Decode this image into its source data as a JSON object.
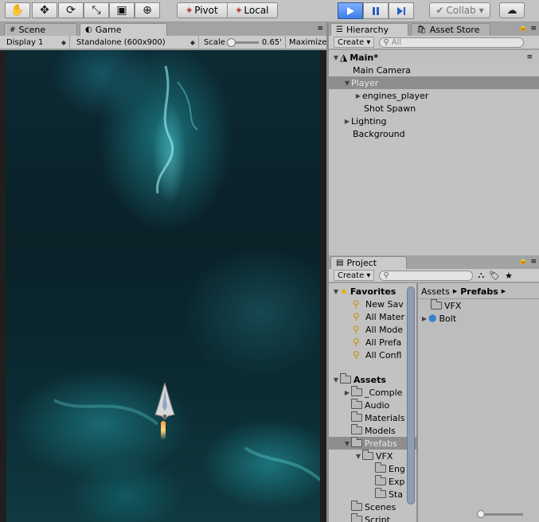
{
  "toolbar": {
    "tools": [
      {
        "name": "hand-tool",
        "glyph": "✋"
      },
      {
        "name": "move-tool",
        "glyph": "✥"
      },
      {
        "name": "rotate-tool",
        "glyph": "⟳"
      },
      {
        "name": "scale-tool",
        "glyph": "⤡"
      },
      {
        "name": "rect-tool",
        "glyph": "▣"
      },
      {
        "name": "transform-tool",
        "glyph": "⊕"
      }
    ],
    "pivot_label": "Pivot",
    "local_label": "Local",
    "collab_label": "Collab ▾",
    "colors": {
      "play_active": "#3f7ee8"
    }
  },
  "scene_tab": "Scene",
  "game_tab": "Game",
  "game_bar": {
    "display": "Display 1",
    "resolution": "Standalone (600x900)",
    "scale_label": "Scale",
    "scale_value": "0.65'",
    "maximize": "Maximize"
  },
  "hierarchy": {
    "tab": "Hierarchy",
    "other_tab": "Asset Store",
    "create": "Create ▾",
    "search_placeholder": "All",
    "scene_name": "Main*",
    "items": [
      {
        "label": "Main Camera"
      },
      {
        "label": "Player"
      },
      {
        "label": "engines_player"
      },
      {
        "label": "Shot Spawn"
      },
      {
        "label": "Lighting"
      },
      {
        "label": "Background"
      }
    ]
  },
  "project": {
    "tab": "Project",
    "create": "Create ▾",
    "favorites_label": "Favorites",
    "favorites": [
      "New Sav",
      "All Mater",
      "All Mode",
      "All Prefa",
      "All Confl"
    ],
    "assets_label": "Assets",
    "tree": [
      "_Comple",
      "Audio",
      "Materials",
      "Models",
      "Prefabs",
      "VFX",
      "Eng",
      "Exp",
      "Sta",
      "Scenes",
      "Script"
    ],
    "breadcrumb_root": "Assets",
    "breadcrumb_current": "Prefabs",
    "contents": [
      "VFX",
      "Bolt"
    ]
  }
}
